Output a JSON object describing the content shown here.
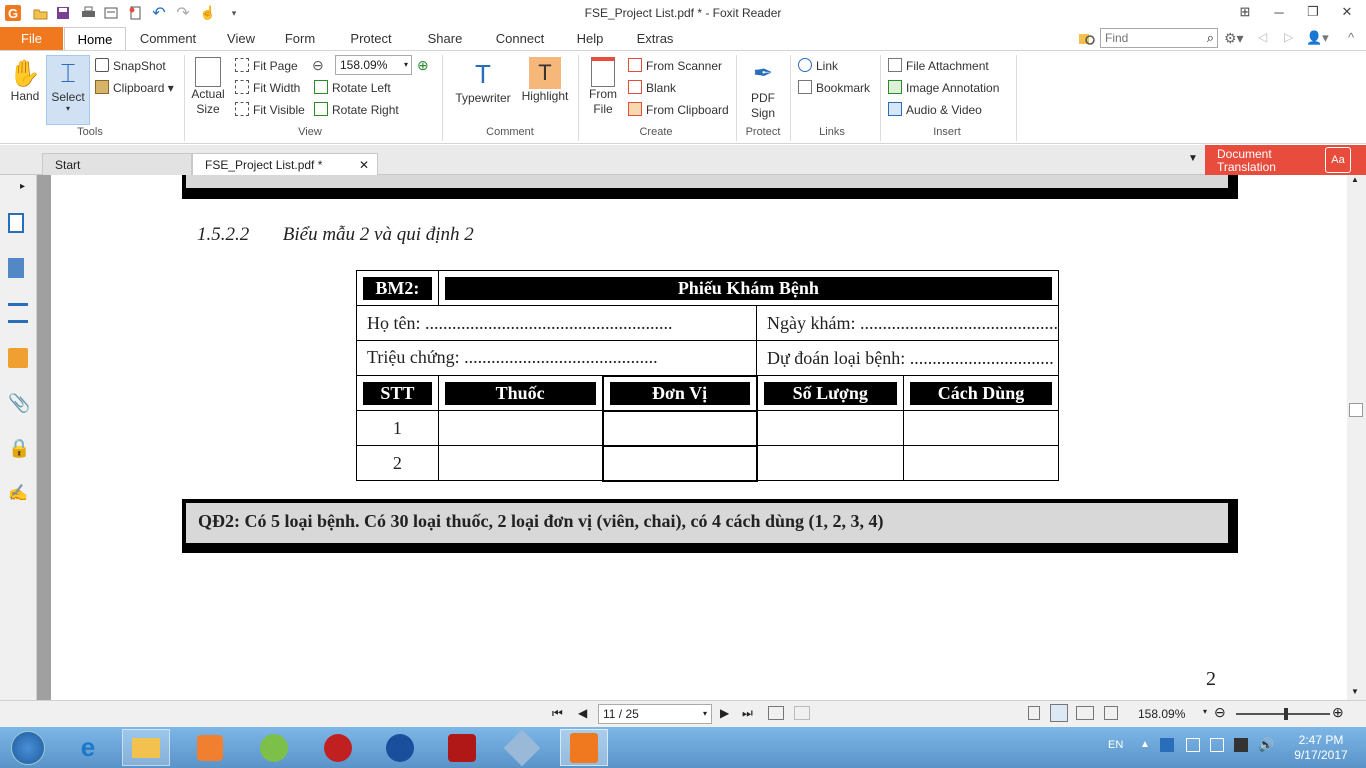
{
  "window": {
    "title": "FSE_Project List.pdf * - Foxit Reader"
  },
  "menu": {
    "tabs": [
      "File",
      "Home",
      "Comment",
      "View",
      "Form",
      "Protect",
      "Share",
      "Connect",
      "Help",
      "Extras"
    ],
    "search_placeholder": "Find"
  },
  "ribbon": {
    "tools": {
      "hand": "Hand",
      "select": "Select",
      "snapshot": "SnapShot",
      "clipboard": "Clipboard",
      "label": "Tools"
    },
    "view": {
      "actual_size_1": "Actual",
      "actual_size_2": "Size",
      "fit_page": "Fit Page",
      "fit_width": "Fit Width",
      "fit_visible": "Fit Visible",
      "zoom": "158.09%",
      "rotate_left": "Rotate Left",
      "rotate_right": "Rotate Right",
      "label": "View"
    },
    "comment": {
      "typewriter": "Typewriter",
      "highlight": "Highlight",
      "label": "Comment"
    },
    "create": {
      "from_file_1": "From",
      "from_file_2": "File",
      "from_scanner": "From Scanner",
      "blank": "Blank",
      "from_clipboard": "From Clipboard",
      "label": "Create"
    },
    "protect": {
      "pdf_sign_1": "PDF",
      "pdf_sign_2": "Sign",
      "label": "Protect"
    },
    "links": {
      "link": "Link",
      "bookmark": "Bookmark",
      "label": "Links"
    },
    "insert": {
      "file_attachment": "File Attachment",
      "image_annotation": "Image Annotation",
      "audio_video": "Audio & Video",
      "label": "Insert"
    }
  },
  "doc_tabs": {
    "start": "Start",
    "current": "FSE_Project List.pdf *",
    "translation_1": "Document",
    "translation_2": "Translation"
  },
  "document": {
    "heading_number": "1.5.2.2",
    "heading_text": "Biểu mẫu 2 và qui định 2",
    "form_code": "BM2:",
    "form_title": "Phiếu Khám Bệnh",
    "name_label": "Họ tên:",
    "name_dots": ".......................................................",
    "date_label": "Ngày khám:",
    "date_dots": "............................................",
    "symptom_label": "Triệu chứng:",
    "symptom_dots": "...........................................",
    "diagnosis_label": "Dự đoán loại bệnh:",
    "diagnosis_dots": "................................",
    "columns": [
      "STT",
      "Thuốc",
      "Đơn Vị",
      "Số Lượng",
      "Cách Dùng"
    ],
    "rows": [
      "1",
      "2"
    ],
    "rule": "QĐ2: Có 5 loại bệnh. Có 30 loại thuốc, 2 loại đơn vị (viên, chai), có 4 cách dùng (1, 2, 3, 4)",
    "page_number": "2"
  },
  "status": {
    "page_indicator": "11 / 25",
    "zoom": "158.09%"
  },
  "taskbar": {
    "language": "EN",
    "time": "2:47 PM",
    "date": "9/17/2017"
  },
  "colors": {
    "accent": "#f0781e",
    "translate": "#e84c3d",
    "taskbar": "#6aa3d6"
  }
}
